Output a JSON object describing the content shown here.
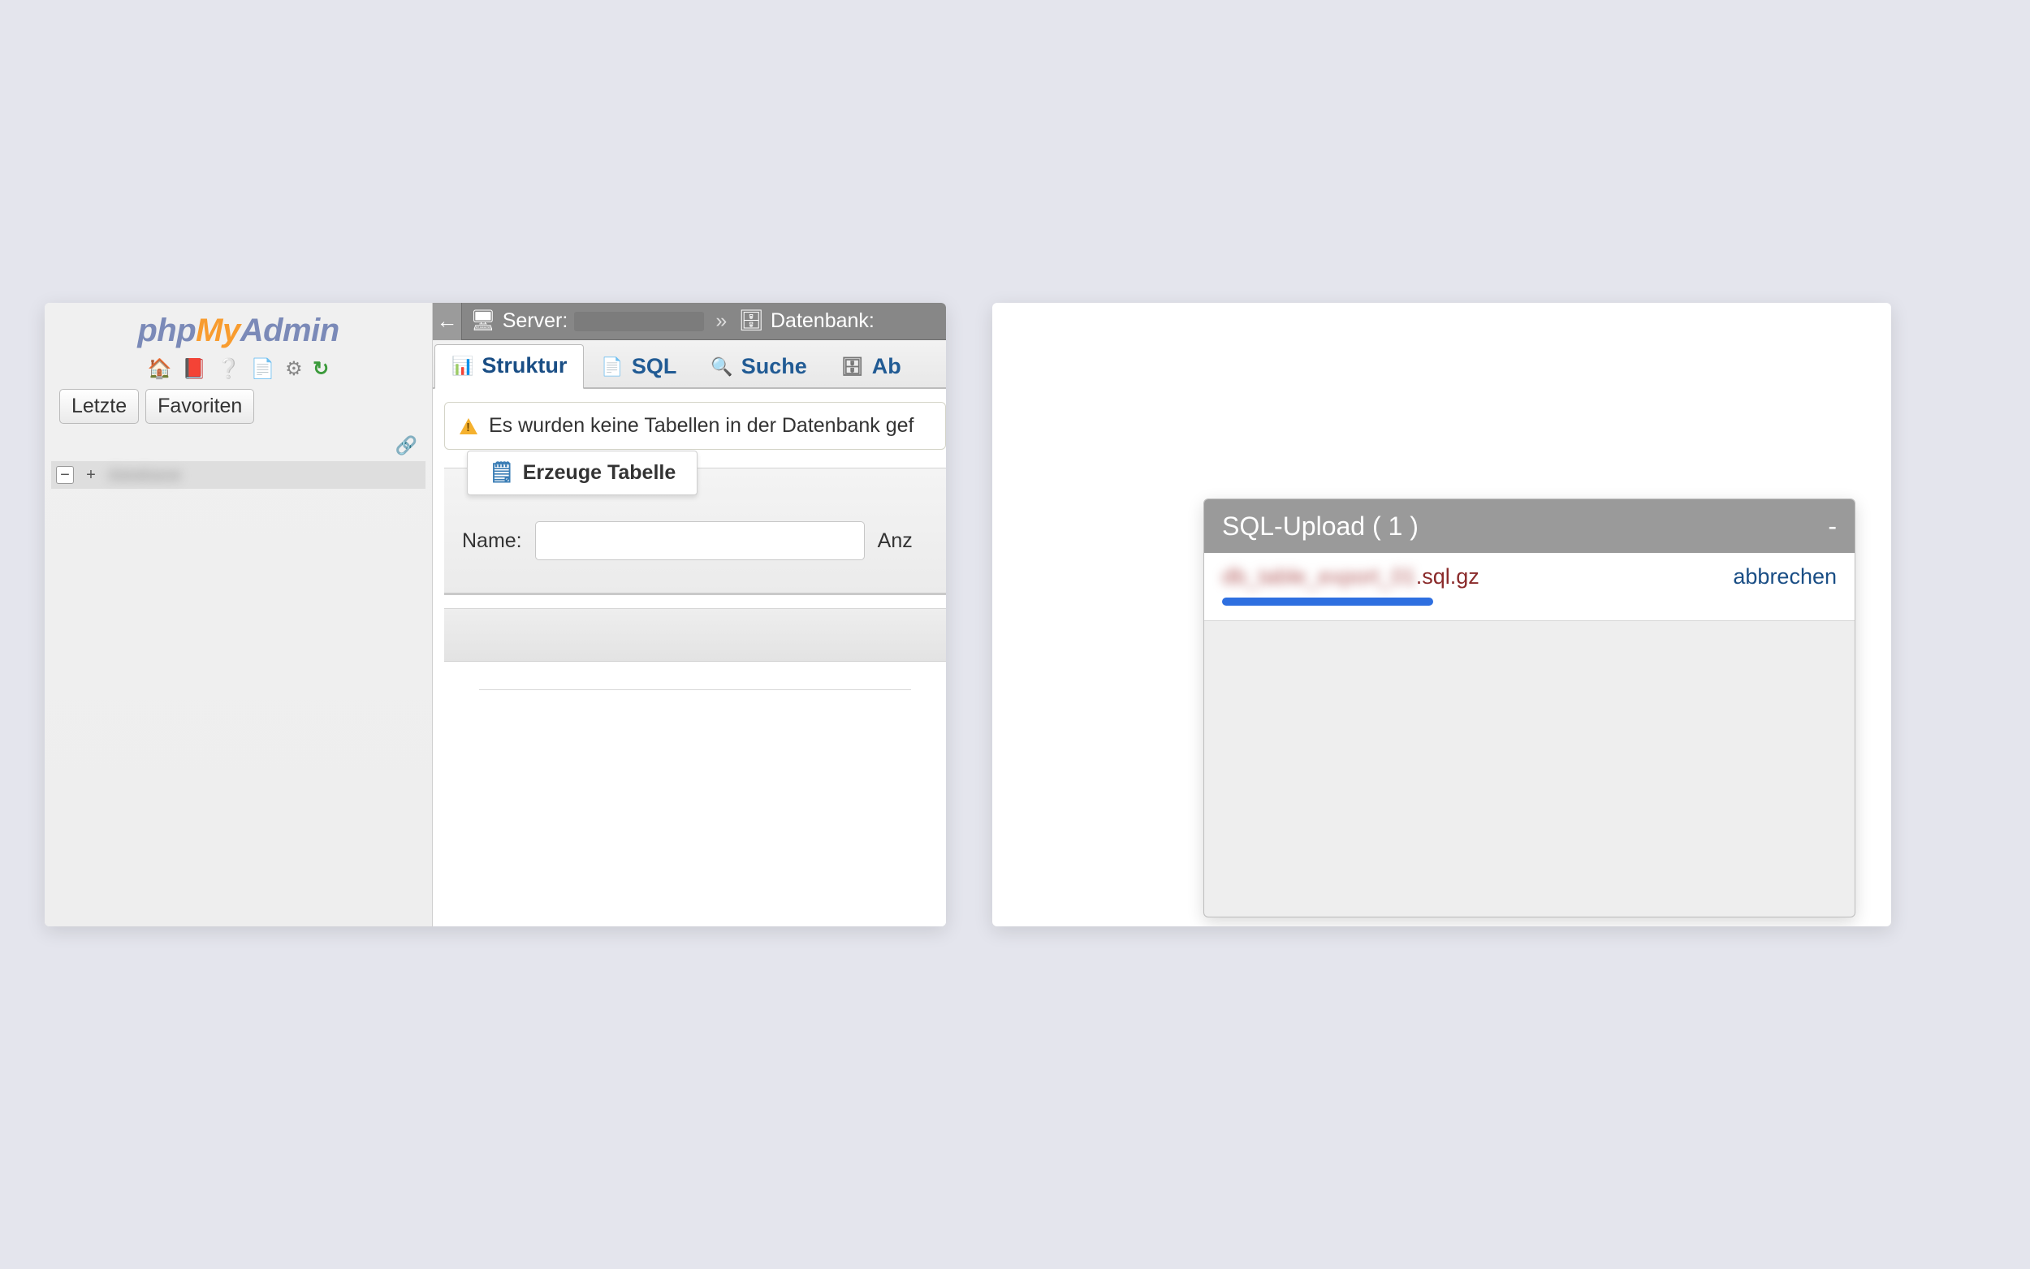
{
  "sidebar": {
    "logo": {
      "php": "php",
      "my": "My",
      "admin": "Admin"
    },
    "tabs": {
      "recent": "Letzte",
      "favorites": "Favoriten"
    },
    "tree": {
      "minus": "−",
      "plus": "+"
    }
  },
  "breadcrumb": {
    "server_label": "Server:",
    "db_label": "Datenbank:"
  },
  "tabs": {
    "structure": "Struktur",
    "sql": "SQL",
    "search": "Suche",
    "query": "Ab"
  },
  "alert": {
    "message": "Es wurden keine Tabellen in der Datenbank gef"
  },
  "create": {
    "legend": "Erzeuge Tabelle",
    "name_label": "Name:",
    "cols_label": "Anz"
  },
  "upload": {
    "title": "SQL-Upload ( 1 )",
    "minimize": "-",
    "file_ext": ".sql.gz",
    "cancel": "abbrechen"
  }
}
